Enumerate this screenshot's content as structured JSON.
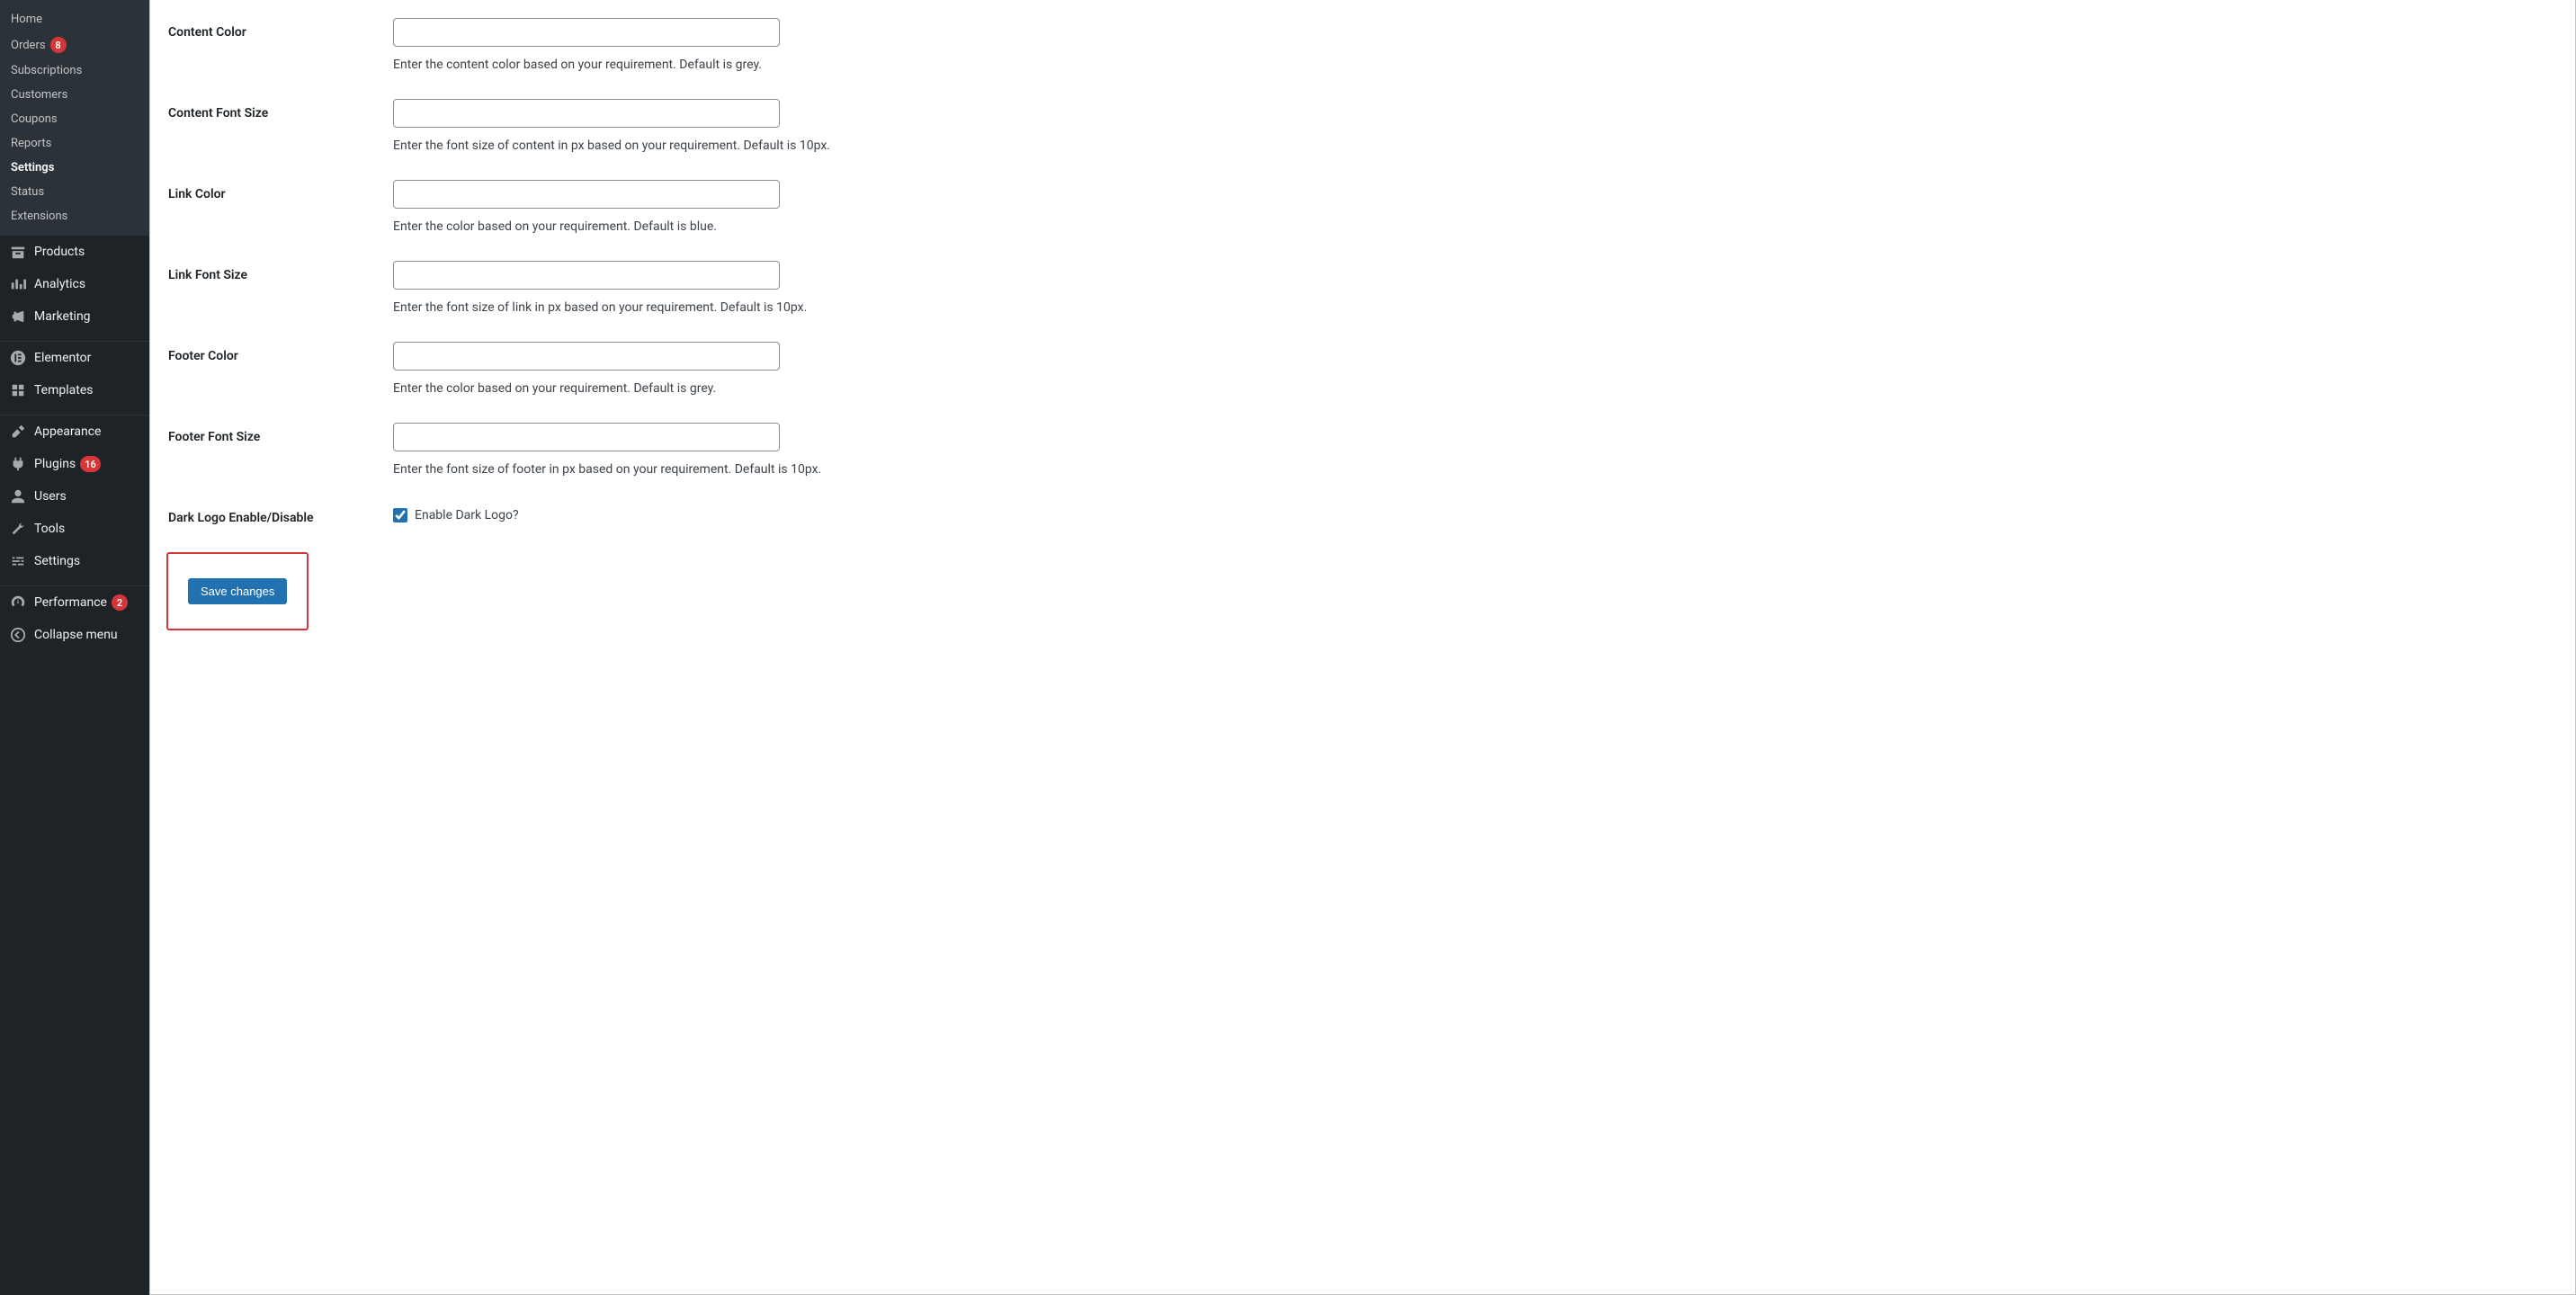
{
  "sidebar": {
    "submenu": {
      "items": [
        {
          "label": "Home"
        },
        {
          "label": "Orders",
          "badge": "8"
        },
        {
          "label": "Subscriptions"
        },
        {
          "label": "Customers"
        },
        {
          "label": "Coupons"
        },
        {
          "label": "Reports"
        },
        {
          "label": "Settings",
          "active": true
        },
        {
          "label": "Status"
        },
        {
          "label": "Extensions"
        }
      ]
    },
    "menu": {
      "products": "Products",
      "analytics": "Analytics",
      "marketing": "Marketing",
      "elementor": "Elementor",
      "templates": "Templates",
      "appearance": "Appearance",
      "plugins": "Plugins",
      "plugins_badge": "16",
      "users": "Users",
      "tools": "Tools",
      "settings": "Settings",
      "performance": "Performance",
      "performance_badge": "2",
      "collapse": "Collapse menu"
    }
  },
  "form": {
    "content_color": {
      "label": "Content Color",
      "description": "Enter the content color based on your requirement. Default is grey."
    },
    "content_font_size": {
      "label": "Content Font Size",
      "description": "Enter the font size of content in px based on your requirement. Default is 10px."
    },
    "link_color": {
      "label": "Link Color",
      "description": "Enter the color based on your requirement. Default is blue."
    },
    "link_font_size": {
      "label": "Link Font Size",
      "description": "Enter the font size of link in px based on your requirement. Default is 10px."
    },
    "footer_color": {
      "label": "Footer Color",
      "description": "Enter the color based on your requirement. Default is grey."
    },
    "footer_font_size": {
      "label": "Footer Font Size",
      "description": "Enter the font size of footer in px based on your requirement. Default is 10px."
    },
    "dark_logo": {
      "label": "Dark Logo Enable/Disable",
      "checkbox_label": "Enable Dark Logo?"
    },
    "save_button": "Save changes"
  }
}
